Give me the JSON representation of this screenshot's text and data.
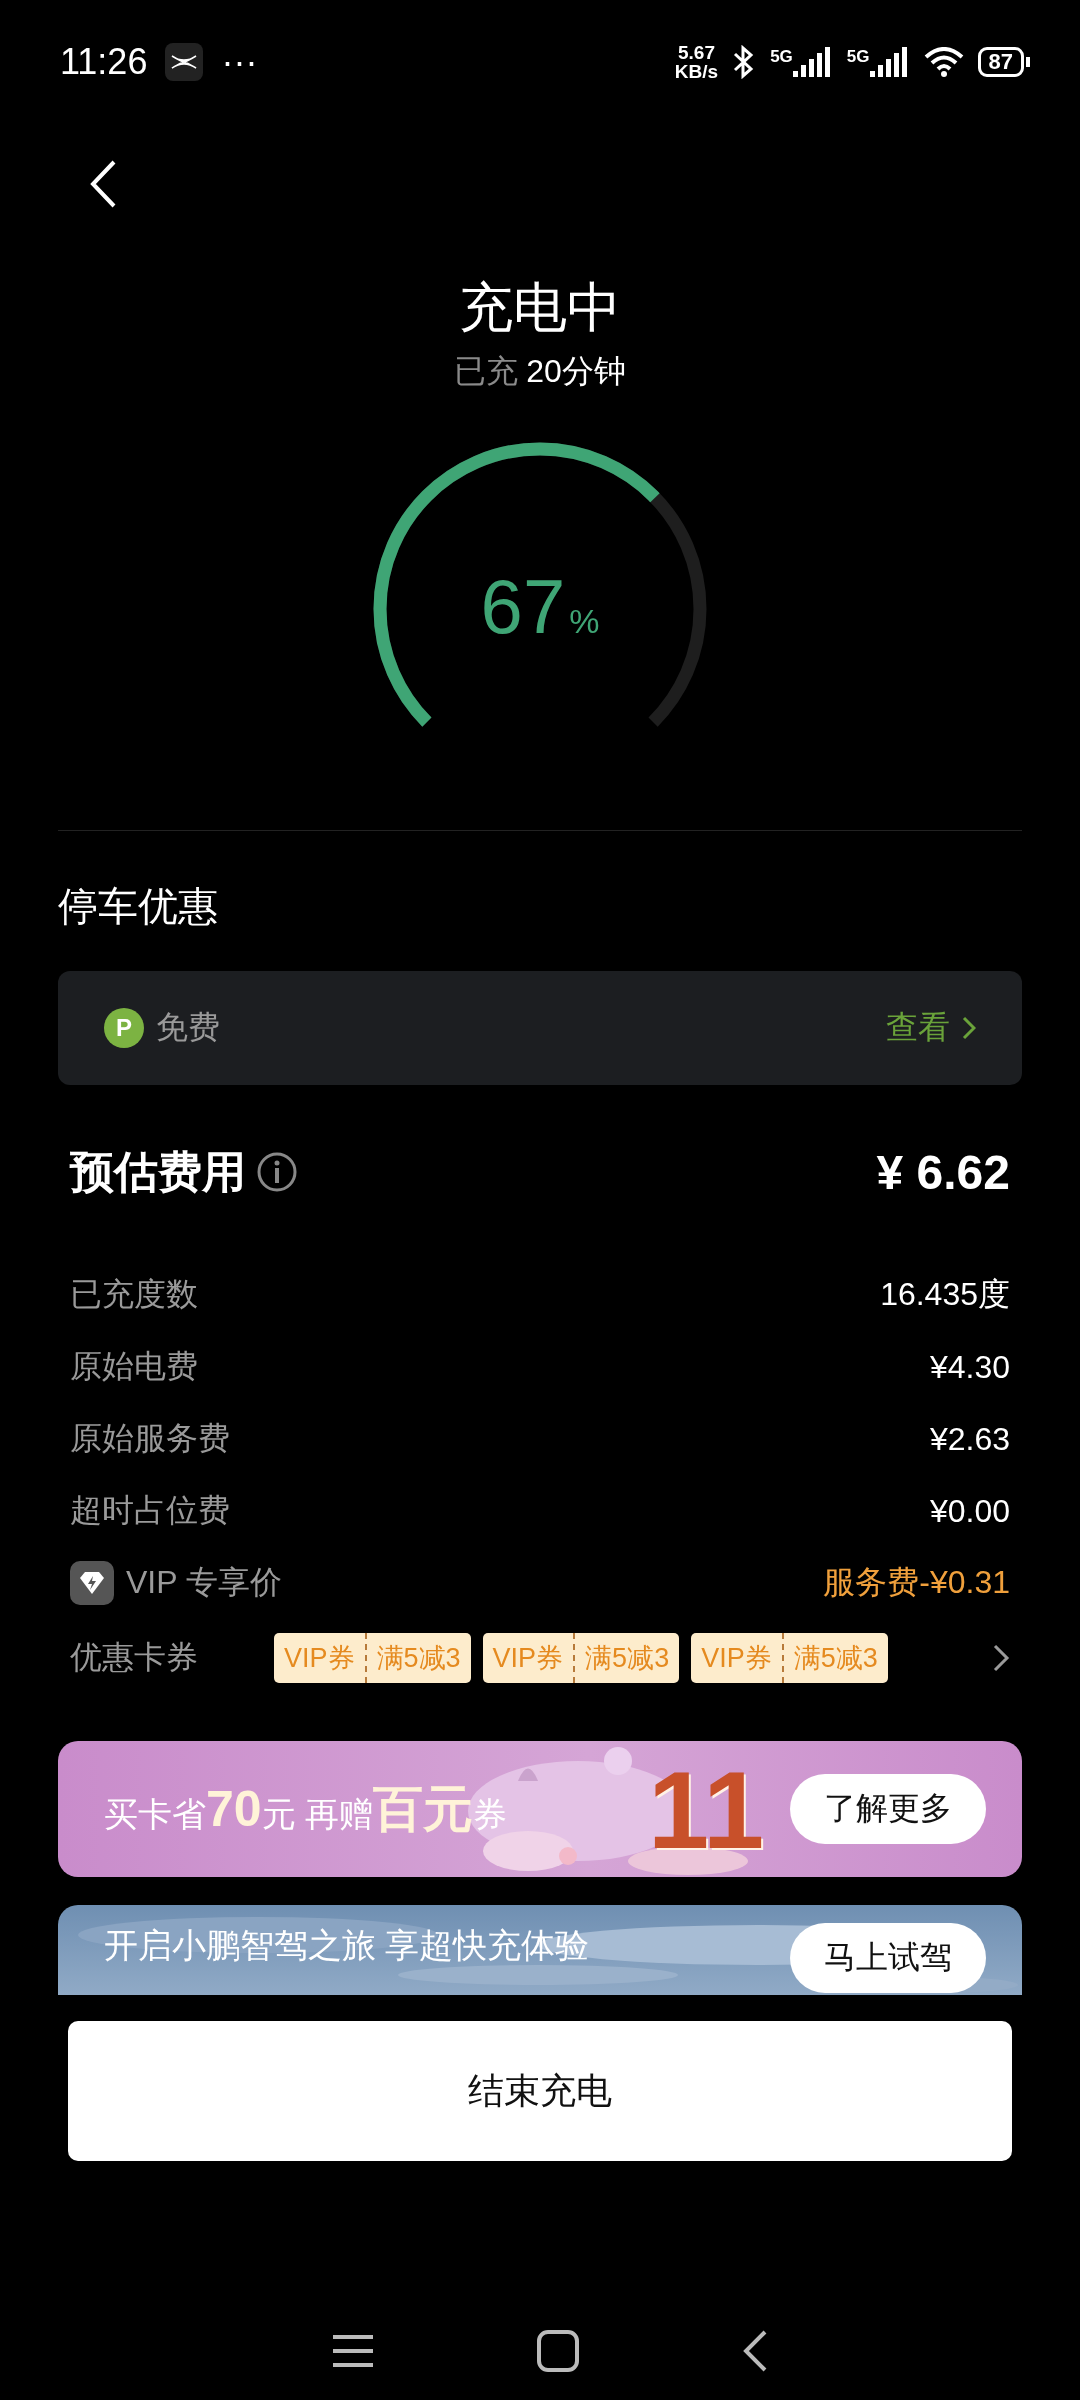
{
  "status_bar": {
    "time": "11:26",
    "more": "···",
    "net_speed": [
      "5.67",
      "KB/s"
    ],
    "signal_labels": [
      "5G",
      "5G"
    ],
    "battery": "87"
  },
  "header": {
    "title": "充电中",
    "elapsed_label": "已充",
    "elapsed_value": "20分钟"
  },
  "gauge": {
    "value": "67",
    "unit": "%"
  },
  "parking": {
    "title": "停车优惠",
    "badge": "P",
    "status": "免费",
    "link": "查看"
  },
  "fees": {
    "title": "预估费用",
    "total": "¥ 6.62",
    "rows": [
      {
        "kind": "plain",
        "label": "已充度数",
        "value": "16.435度"
      },
      {
        "kind": "plain",
        "label": "原始电费",
        "value": "¥4.30"
      },
      {
        "kind": "plain",
        "label": "原始服务费",
        "value": "¥2.63"
      },
      {
        "kind": "plain",
        "label": "超时占位费",
        "value": "¥0.00"
      },
      {
        "kind": "vip",
        "label": "VIP 专享价",
        "value": "服务费-¥0.31"
      }
    ],
    "coupons": {
      "label": "优惠卡券",
      "items": [
        {
          "tag": "VIP券",
          "offer": "满5减3"
        },
        {
          "tag": "VIP券",
          "offer": "满5减3"
        },
        {
          "tag": "VIP券",
          "offer": "满5减3"
        }
      ]
    }
  },
  "banners": [
    {
      "kind": "festival",
      "text": "买卡省**70**元 再赠**百元**券",
      "art": "11",
      "button": "了解更多"
    },
    {
      "kind": "sky",
      "text": "开启小鹏智驾之旅 享超快充体验",
      "button": "马上试驾"
    }
  ],
  "end_button": "结束充电"
}
